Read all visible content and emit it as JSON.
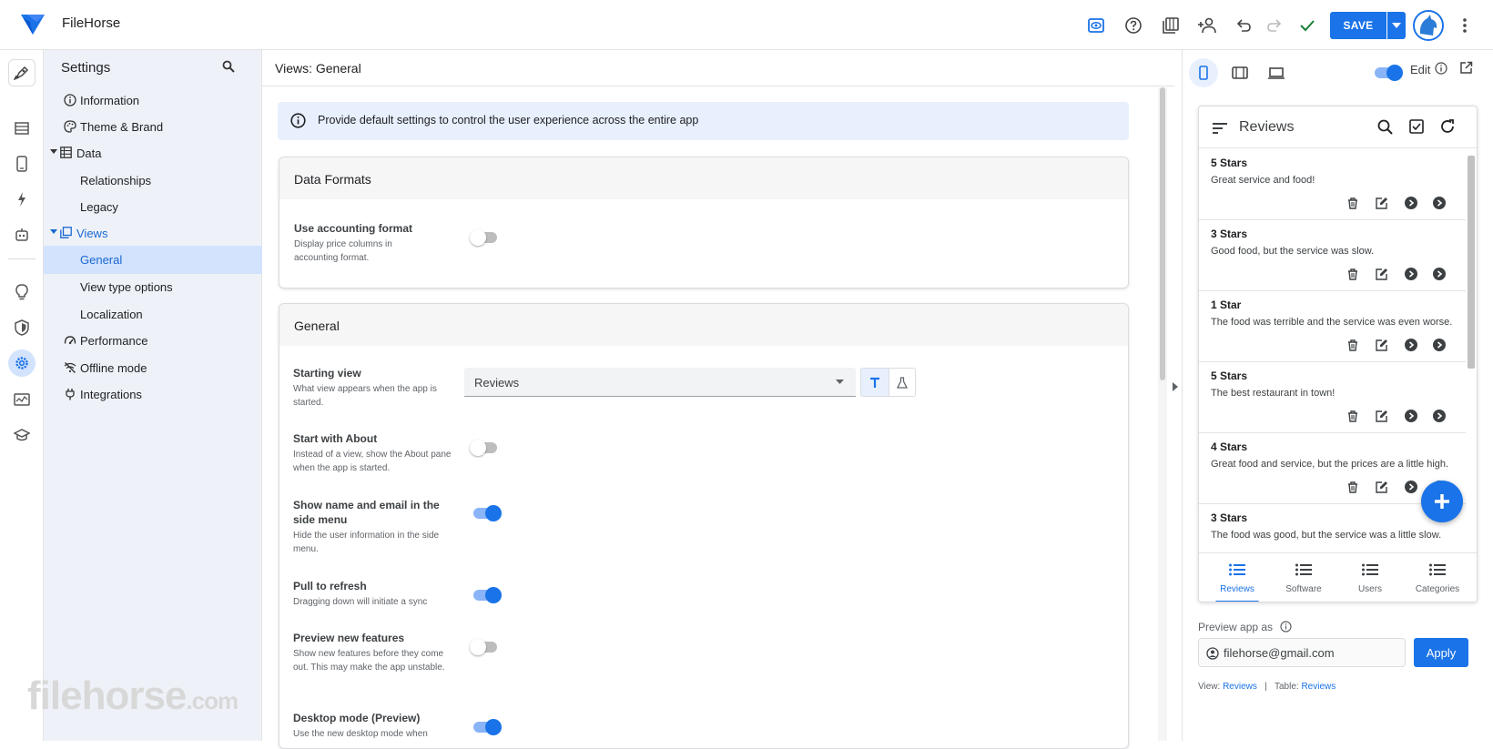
{
  "app": {
    "name": "FileHorse",
    "watermark": "filehorse",
    "watermark_suffix": ".com"
  },
  "toolbar": {
    "save_label": "SAVE"
  },
  "settings": {
    "title": "Settings",
    "nav": [
      {
        "label": "Information",
        "icon": "info-icon"
      },
      {
        "label": "Theme & Brand",
        "icon": "palette-icon"
      },
      {
        "label": "Data",
        "icon": "table-icon"
      },
      {
        "label": "Relationships"
      },
      {
        "label": "Legacy"
      },
      {
        "label": "Views",
        "icon": "views-icon"
      },
      {
        "label": "General"
      },
      {
        "label": "View type options"
      },
      {
        "label": "Localization"
      },
      {
        "label": "Performance",
        "icon": "speed-icon"
      },
      {
        "label": "Offline mode",
        "icon": "wifi-off-icon"
      },
      {
        "label": "Integrations",
        "icon": "plug-icon"
      }
    ]
  },
  "main": {
    "title": "Views: General",
    "banner": "Provide default settings to control the user experience across the entire app",
    "data_formats": {
      "heading": "Data Formats",
      "accounting": {
        "label": "Use accounting format",
        "desc": "Display price columns in accounting format.",
        "on": false
      }
    },
    "general": {
      "heading": "General",
      "starting_view": {
        "label": "Starting view",
        "desc": "What view appears when the app is started.",
        "value": "Reviews"
      },
      "start_about": {
        "label": "Start with About",
        "desc": "Instead of a view, show the About pane when the app is started.",
        "on": false
      },
      "show_name": {
        "label": "Show name and email in the side menu",
        "desc": "Hide the user information in the side menu.",
        "on": true
      },
      "pull_refresh": {
        "label": "Pull to refresh",
        "desc": "Dragging down will initiate a sync",
        "on": true
      },
      "preview_features": {
        "label": "Preview new features",
        "desc": "Show new features before they come out. This may make the app unstable.",
        "on": false
      },
      "desktop_mode": {
        "label": "Desktop mode (Preview)",
        "desc": "Use the new desktop mode when",
        "on": true
      }
    }
  },
  "preview": {
    "edit_label": "Edit",
    "edit_on": true,
    "phone": {
      "title": "Reviews",
      "rows": [
        {
          "title": "5 Stars",
          "desc": "Great service and food!"
        },
        {
          "title": "3 Stars",
          "desc": "Good food, but the service was slow."
        },
        {
          "title": "1 Star",
          "desc": "The food was terrible and the service was even worse."
        },
        {
          "title": "5 Stars",
          "desc": "The best restaurant in town!"
        },
        {
          "title": "4 Stars",
          "desc": "Great food and service, but the prices are a little high."
        },
        {
          "title": "3 Stars",
          "desc": "The food was good, but the service was a little slow."
        }
      ],
      "tabs": [
        {
          "label": "Reviews",
          "active": true
        },
        {
          "label": "Software",
          "active": false
        },
        {
          "label": "Users",
          "active": false
        },
        {
          "label": "Categories",
          "active": false
        }
      ]
    },
    "preview_as_label": "Preview app as",
    "email": "filehorse@gmail.com",
    "apply_label": "Apply",
    "footer": {
      "view_label": "View:",
      "view_value": "Reviews",
      "sep": "|",
      "table_label": "Table:",
      "table_value": "Reviews"
    }
  },
  "colors": {
    "accent": "#1a73e8",
    "active_nav_bg": "#d3e3fd",
    "settings_bg": "#eef2f8"
  }
}
